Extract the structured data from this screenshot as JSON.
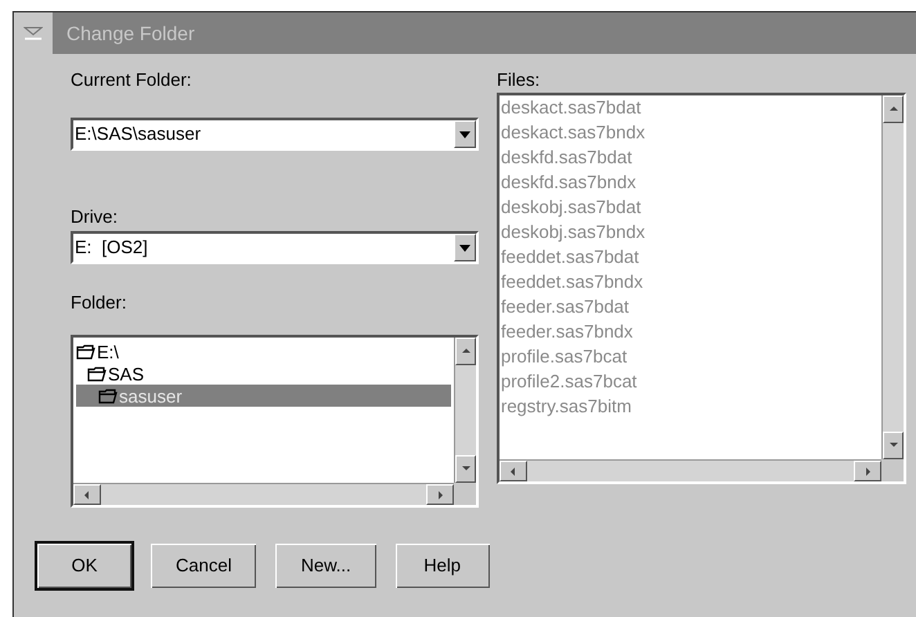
{
  "window": {
    "title": "Change Folder"
  },
  "current_folder": {
    "label": "Current Folder:",
    "value": "E:\\SAS\\sasuser"
  },
  "drive": {
    "label": "Drive:",
    "value": "E:  [OS2]"
  },
  "folder": {
    "label": "Folder:",
    "tree": [
      {
        "label": "E:\\",
        "selected": false,
        "children": [
          {
            "label": "SAS",
            "selected": false,
            "children": [
              {
                "label": "sasuser",
                "selected": true
              }
            ]
          }
        ]
      }
    ]
  },
  "files": {
    "label": "Files:",
    "items": [
      {
        "label": "deskact.sas7bdat",
        "disabled": true
      },
      {
        "label": "deskact.sas7bndx",
        "disabled": true
      },
      {
        "label": "deskfd.sas7bdat",
        "disabled": true
      },
      {
        "label": "deskfd.sas7bndx",
        "disabled": true
      },
      {
        "label": "deskobj.sas7bdat",
        "disabled": true
      },
      {
        "label": "deskobj.sas7bndx",
        "disabled": true
      },
      {
        "label": "feeddet.sas7bdat",
        "disabled": true
      },
      {
        "label": "feeddet.sas7bndx",
        "disabled": true
      },
      {
        "label": "feeder.sas7bdat",
        "disabled": true
      },
      {
        "label": "feeder.sas7bndx",
        "disabled": true
      },
      {
        "label": "profile.sas7bcat",
        "disabled": true
      },
      {
        "label": "profile2.sas7bcat",
        "disabled": true
      },
      {
        "label": "regstry.sas7bitm",
        "disabled": true
      }
    ]
  },
  "buttons": [
    {
      "label": "OK",
      "default": true
    },
    {
      "label": "Cancel",
      "default": false
    },
    {
      "label": "New...",
      "default": false
    },
    {
      "label": "Help",
      "default": false
    }
  ]
}
